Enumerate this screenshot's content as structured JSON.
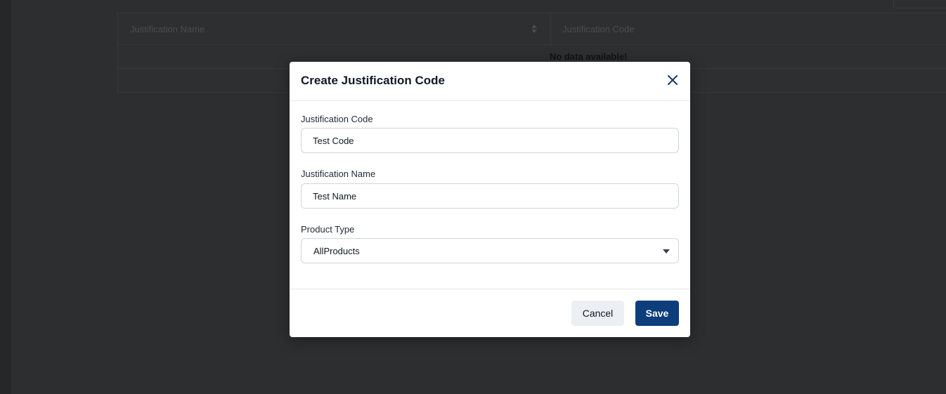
{
  "background": {
    "table": {
      "columns": [
        "Justification Name",
        "Justification Code"
      ],
      "empty_message": "No data available!"
    }
  },
  "modal": {
    "title": "Create Justification Code",
    "fields": {
      "code": {
        "label": "Justification Code",
        "value": "Test Code"
      },
      "name": {
        "label": "Justification Name",
        "value": "Test Name"
      },
      "product_type": {
        "label": "Product Type",
        "value": "AllProducts"
      }
    },
    "buttons": {
      "cancel": "Cancel",
      "save": "Save"
    }
  },
  "colors": {
    "primary": "#0d3e7c",
    "cancel_bg": "#edf0f3",
    "overlay": "#2b2c2d"
  },
  "icons": {
    "close": "close-icon",
    "caret": "caret-down-icon",
    "sort": "sort-icon"
  }
}
